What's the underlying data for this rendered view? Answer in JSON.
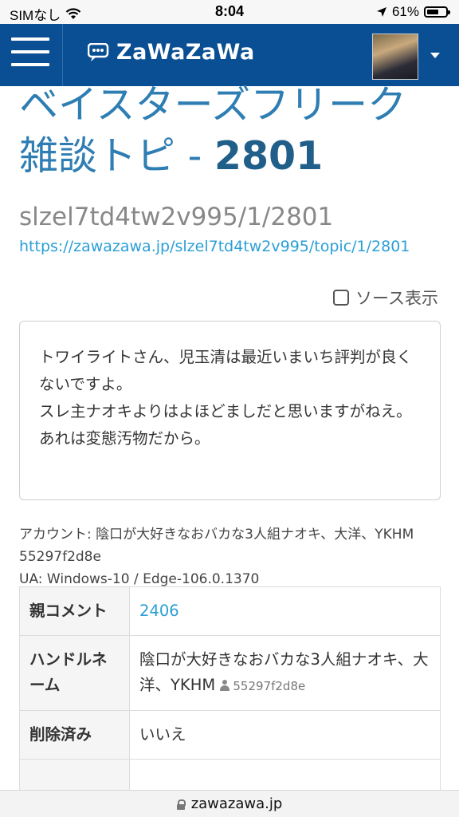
{
  "status_bar": {
    "carrier": "SIMなし",
    "time": "8:04",
    "battery": "61%",
    "icons": [
      "wifi-icon",
      "location-icon",
      "battery-icon"
    ]
  },
  "header": {
    "logo_text": "ZaWaZaWa",
    "menu_icon": "hamburger-icon",
    "brand_color": "#0a4f93"
  },
  "topic": {
    "title": "ベイスターズフリーク雑談トピ - ",
    "number": "2801",
    "slug": " slzel7td4tw2v995/1/2801",
    "url": "https://zawazawa.jp/slzel7td4tw2v995/topic/1/2801"
  },
  "source_toggle": {
    "label": "ソース表示",
    "checked": false
  },
  "comment": {
    "lines": [
      "トワイライトさん、児玉清は最近いまいち評判が良くないですよ。",
      "スレ主ナオキよりはよほどましだと思いますがねえ。",
      "あれは変態汚物だから。"
    ]
  },
  "meta": {
    "account": "アカウント: 陰口が大好きなおバカな3人組ナオキ、大洋、YKHM 55297f2d8e",
    "ua": "UA: Windows-10 / Edge-106.0.1370"
  },
  "info": {
    "parent_label": "親コメント",
    "parent_value": "2406",
    "handle_label": "ハンドルネーム",
    "handle_value": "陰口が大好きなおバカな3人組ナオキ、大洋、YKHM",
    "handle_id": "55297f2d8e",
    "deleted_label": "削除済み",
    "deleted_value": "いいえ"
  },
  "url_bar": {
    "domain": "zawazawa.jp"
  }
}
